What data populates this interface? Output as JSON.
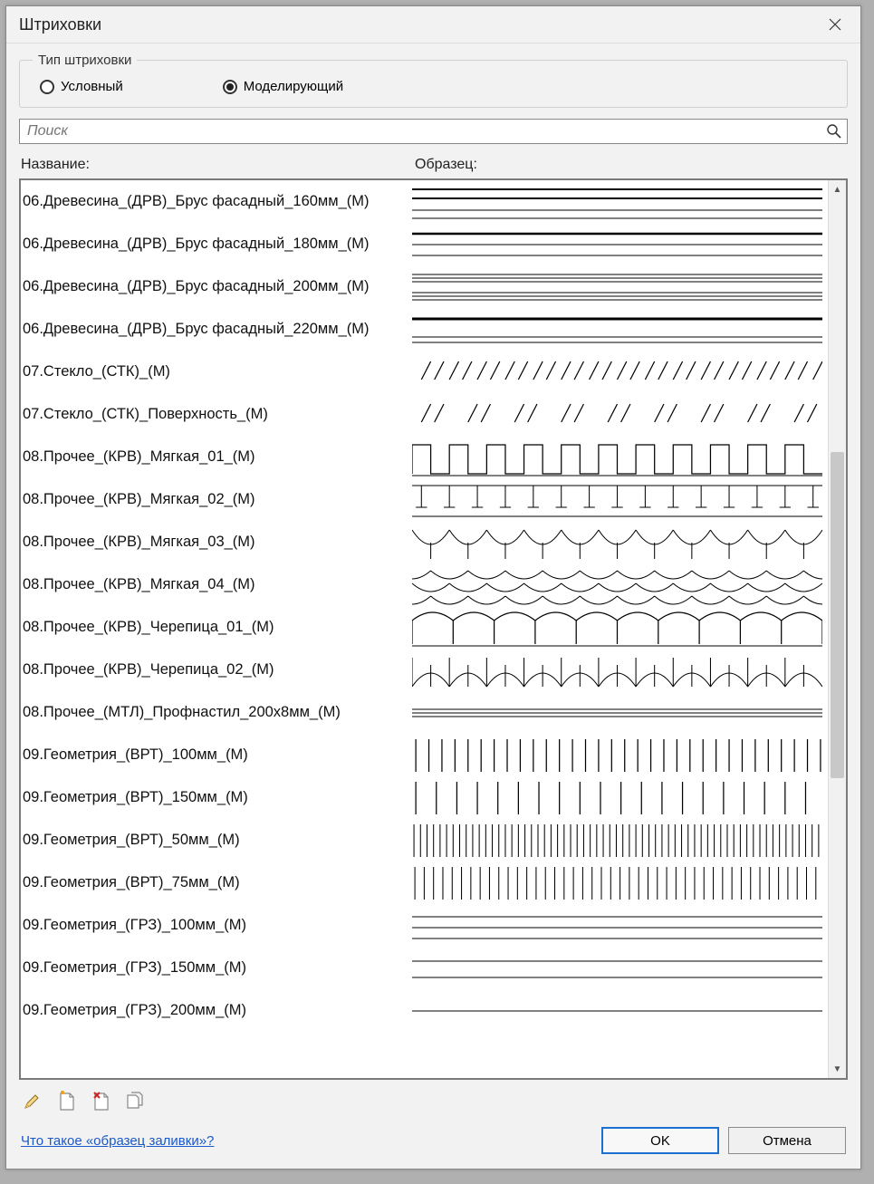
{
  "dialog": {
    "title": "Штриховки"
  },
  "type_group": {
    "legend": "Тип штриховки",
    "option_symbolic": "Условный",
    "option_model": "Моделирующий",
    "selected": "model"
  },
  "search": {
    "placeholder": "Поиск"
  },
  "headers": {
    "name": "Название:",
    "sample": "Образец:"
  },
  "items": [
    {
      "name": "06.Древесина_(ДРВ)_Брус фасадный_160мм_(М)",
      "pattern": "hline4"
    },
    {
      "name": "06.Древесина_(ДРВ)_Брус фасадный_180мм_(М)",
      "pattern": "hline_double_thin"
    },
    {
      "name": "06.Древесина_(ДРВ)_Брус фасадный_200мм_(М)",
      "pattern": "hline_triple_thin"
    },
    {
      "name": "06.Древесина_(ДРВ)_Брус фасадный_220мм_(М)",
      "pattern": "hline_double2"
    },
    {
      "name": "07.Стекло_(СТК)_(М)",
      "pattern": "diag_ticks"
    },
    {
      "name": "07.Стекло_(СТК)_Поверхность_(М)",
      "pattern": "diag_ticks_sparse"
    },
    {
      "name": "08.Прочее_(КРВ)_Мягкая_01_(М)",
      "pattern": "battlement"
    },
    {
      "name": "08.Прочее_(КРВ)_Мягкая_02_(М)",
      "pattern": "Tspikes"
    },
    {
      "name": "08.Прочее_(КРВ)_Мягкая_03_(М)",
      "pattern": "arcs_down"
    },
    {
      "name": "08.Прочее_(КРВ)_Мягкая_04_(М)",
      "pattern": "scales"
    },
    {
      "name": "08.Прочее_(КРВ)_Черепица_01_(М)",
      "pattern": "arch1"
    },
    {
      "name": "08.Прочее_(КРВ)_Черепица_02_(М)",
      "pattern": "arch2"
    },
    {
      "name": "08.Прочее_(МТЛ)_Профнастил_200х8мм_(М)",
      "pattern": "profnastil"
    },
    {
      "name": "09.Геометрия_(ВРТ)_100мм_(М)",
      "pattern": "vlines_100"
    },
    {
      "name": "09.Геометрия_(ВРТ)_150мм_(М)",
      "pattern": "vlines_150"
    },
    {
      "name": "09.Геометрия_(ВРТ)_50мм_(М)",
      "pattern": "vlines_50"
    },
    {
      "name": "09.Геометрия_(ВРТ)_75мм_(М)",
      "pattern": "vlines_75"
    },
    {
      "name": "09.Геометрия_(ГРЗ)_100мм_(М)",
      "pattern": "hlines_100"
    },
    {
      "name": "09.Геометрия_(ГРЗ)_150мм_(М)",
      "pattern": "hlines_150"
    },
    {
      "name": "09.Геометрия_(ГРЗ)_200мм_(М)",
      "pattern": "hlines_200"
    }
  ],
  "footer": {
    "help_link": "Что такое «образец заливки»?",
    "ok": "OK",
    "cancel": "Отмена"
  }
}
